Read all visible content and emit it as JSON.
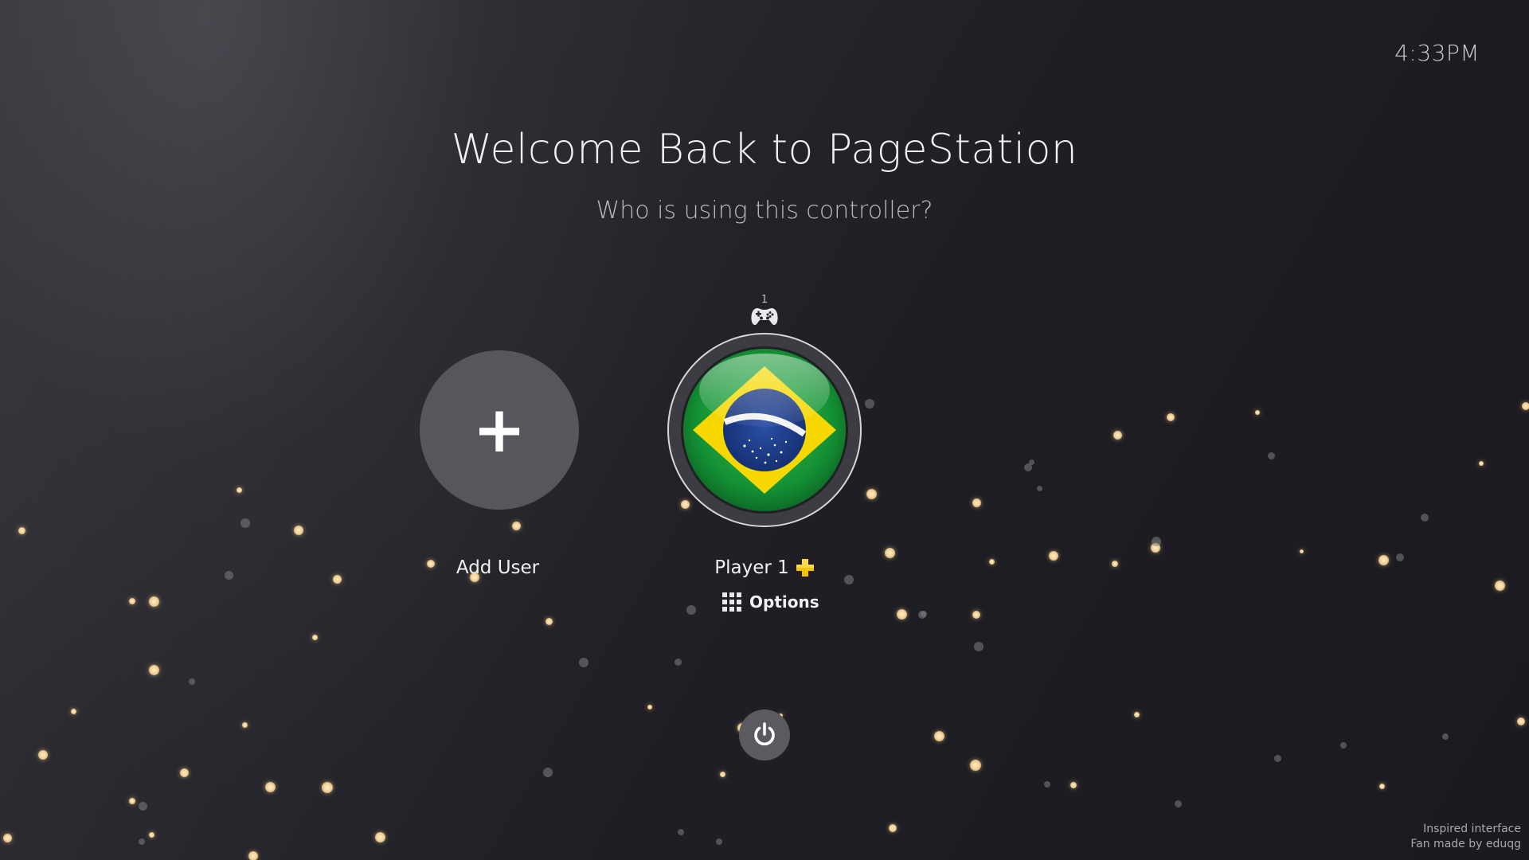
{
  "clock": {
    "time": "4:33PM"
  },
  "header": {
    "title": "Welcome Back to PageStation",
    "subtitle": "Who is using this controller?"
  },
  "users": {
    "add_user": {
      "label": "Add User",
      "icon": "plus-icon"
    },
    "player": {
      "controller_number": "1",
      "controller_icon": "gamepad-icon",
      "name": "Player 1",
      "avatar": "brazil-flag",
      "badge_icon": "plus-membership-icon",
      "options_label": "Options",
      "options_icon": "grid-icon"
    }
  },
  "power": {
    "icon": "power-icon"
  },
  "credits": {
    "line1": "Inspired interface",
    "line2": "Fan made by eduqg"
  },
  "colors": {
    "background": "#1d1c22",
    "accent_gold": "#f2c400",
    "flag_green": "#1f9a3a",
    "flag_yellow": "#f6d800",
    "flag_blue": "#1f3f8c"
  }
}
